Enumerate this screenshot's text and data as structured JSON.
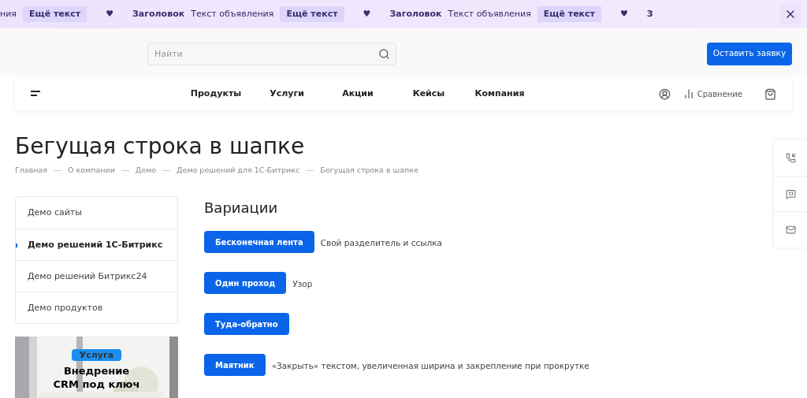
{
  "ticker": [
    {
      "kind": "text",
      "text": "ния"
    },
    {
      "kind": "tag",
      "text": "Ещё текст"
    },
    {
      "kind": "icon",
      "text": "♥"
    },
    {
      "kind": "title",
      "text": "Заголовок"
    },
    {
      "kind": "text",
      "text": "Текст объявления"
    },
    {
      "kind": "tag",
      "text": "Ещё текст"
    },
    {
      "kind": "icon",
      "text": "♥"
    },
    {
      "kind": "title",
      "text": "Заголовок"
    },
    {
      "kind": "text",
      "text": "Текст объявления"
    },
    {
      "kind": "tag",
      "text": "Ещё текст"
    },
    {
      "kind": "icon",
      "text": "♥"
    },
    {
      "kind": "title",
      "text": "З"
    }
  ],
  "search": {
    "placeholder": "Найти"
  },
  "cta_button": "Оставить заявку",
  "nav": {
    "items": [
      "Продукты",
      "Услуги",
      "Акции",
      "Кейсы",
      "Компания"
    ],
    "compare": "Сравнение"
  },
  "page_title": "Бегущая строка в шапке",
  "breadcrumbs": [
    "Главная",
    "О компании",
    "Демо",
    "Демо решений для 1С-Битрикс",
    "Бегущая строка в шапке"
  ],
  "sidebar": {
    "items": [
      {
        "label": "Демо сайты",
        "selected": false
      },
      {
        "label": "Демо решений 1С-Битрикс",
        "selected": true
      },
      {
        "label": "Демо решений Битрикс24",
        "selected": false
      },
      {
        "label": "Демо продуктов",
        "selected": false
      }
    ]
  },
  "promo": {
    "kind": "picture",
    "badge": "Услуга",
    "title": "Внедрение CRM под ключ"
  },
  "variations": {
    "title": "Вариации",
    "items": [
      {
        "button": "Бесконечная лента",
        "note": "Свой разделитель и ссылка"
      },
      {
        "button": "Один проход",
        "note": "Узор"
      },
      {
        "button": "Туда-обратно"
      },
      {
        "button": "Маятник",
        "note": "«Закрыть» текстом, увеличенная ширина и закрепление при прокрутке"
      }
    ]
  }
}
